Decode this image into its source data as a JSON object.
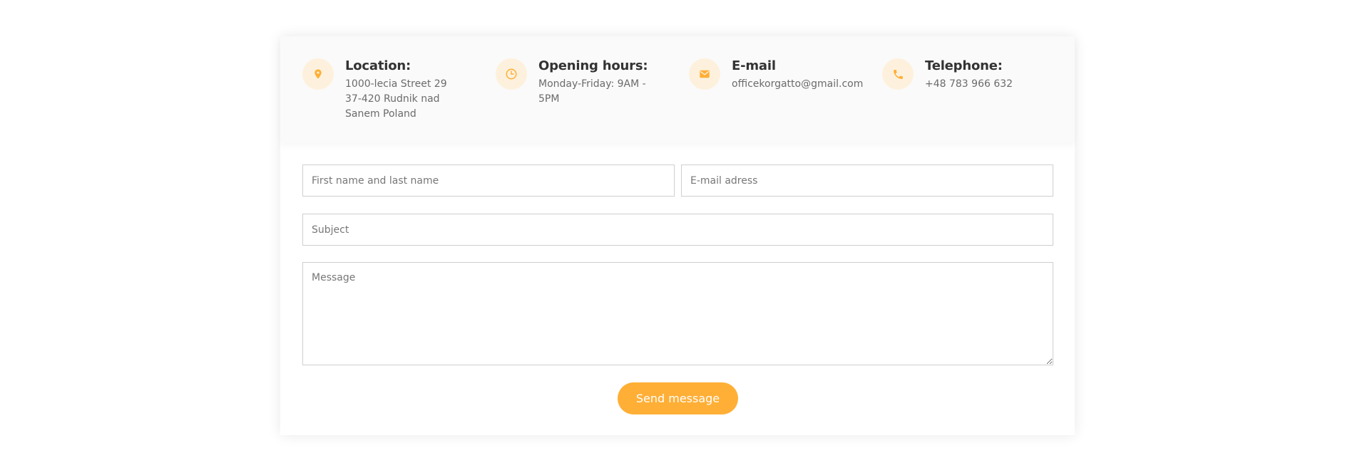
{
  "contact_info": [
    {
      "icon": "location-pin-icon",
      "title": "Location:",
      "lines": [
        "1000-lecia Street 29",
        "37-420 Rudnik nad",
        "Sanem Poland"
      ]
    },
    {
      "icon": "clock-icon",
      "title": "Opening hours:",
      "lines": [
        "Monday-Friday: 9AM -",
        "5PM"
      ]
    },
    {
      "icon": "envelope-icon",
      "title": "E-mail",
      "lines": [
        "officekorgatto@gmail.com"
      ]
    },
    {
      "icon": "phone-icon",
      "title": "Telephone:",
      "lines": [
        "+48 783 966 632"
      ]
    }
  ],
  "form": {
    "name_placeholder": "First name and last name",
    "email_placeholder": "E-mail adress",
    "subject_placeholder": "Subject",
    "message_placeholder": "Message",
    "submit_label": "Send message"
  },
  "colors": {
    "accent": "#ffaf36",
    "icon_circle": "#fdf1dd",
    "title_text": "#333333",
    "body_text": "#6b6b6b",
    "field_border": "#cfcfcf",
    "info_band": "#fafafa"
  }
}
